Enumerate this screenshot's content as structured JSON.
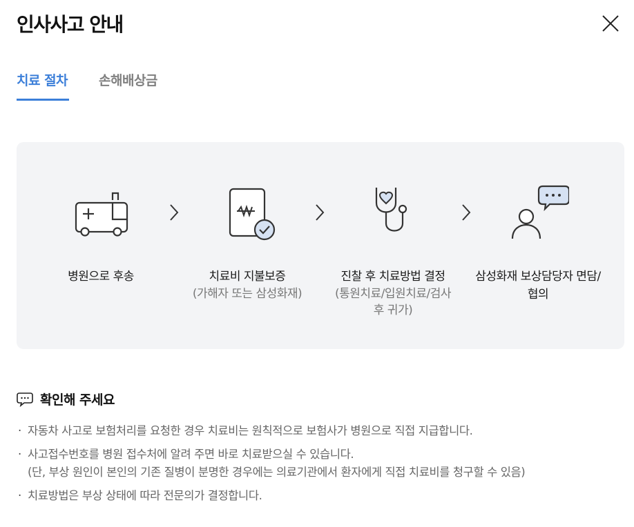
{
  "modal": {
    "title": "인사사고 안내",
    "close_icon": "close-icon"
  },
  "tabs": [
    {
      "label": "치료 절차",
      "active": true
    },
    {
      "label": "손해배상금",
      "active": false
    }
  ],
  "accent_color": "#3c7fd9",
  "steps": [
    {
      "icon": "ambulance-icon",
      "label": "병원으로 후송",
      "sub": ""
    },
    {
      "icon": "payment-guarantee-document-icon",
      "label": "치료비 지불보증",
      "sub": "(가해자 또는 삼성화재)"
    },
    {
      "icon": "stethoscope-icon",
      "label": "진찰 후 치료방법 결정",
      "sub": "(통원치료/입원치료/검사 후 귀가)"
    },
    {
      "icon": "consultant-chat-icon",
      "label": "삼성화재 보상담당자 면담/협의",
      "sub": ""
    }
  ],
  "notice": {
    "icon": "speech-bubble-icon",
    "title": "확인해 주세요",
    "items": [
      {
        "bullet": "·",
        "lines": [
          "자동차 사고로 보험처리를 요청한 경우 치료비는 원칙적으로 보험사가 병원으로 직접 지급합니다."
        ]
      },
      {
        "bullet": "·",
        "lines": [
          "사고접수번호를 병원 접수처에 알려 주면 바로 치료받으실 수 있습니다.",
          "(단, 부상 원인이 본인의 기존 질병이 분명한 경우에는 의료기관에서 환자에게 직접 치료비를 청구할 수 있음)"
        ]
      },
      {
        "bullet": "·",
        "lines": [
          "치료방법은 부상 상태에 따라 전문의가 결정합니다."
        ]
      }
    ]
  }
}
